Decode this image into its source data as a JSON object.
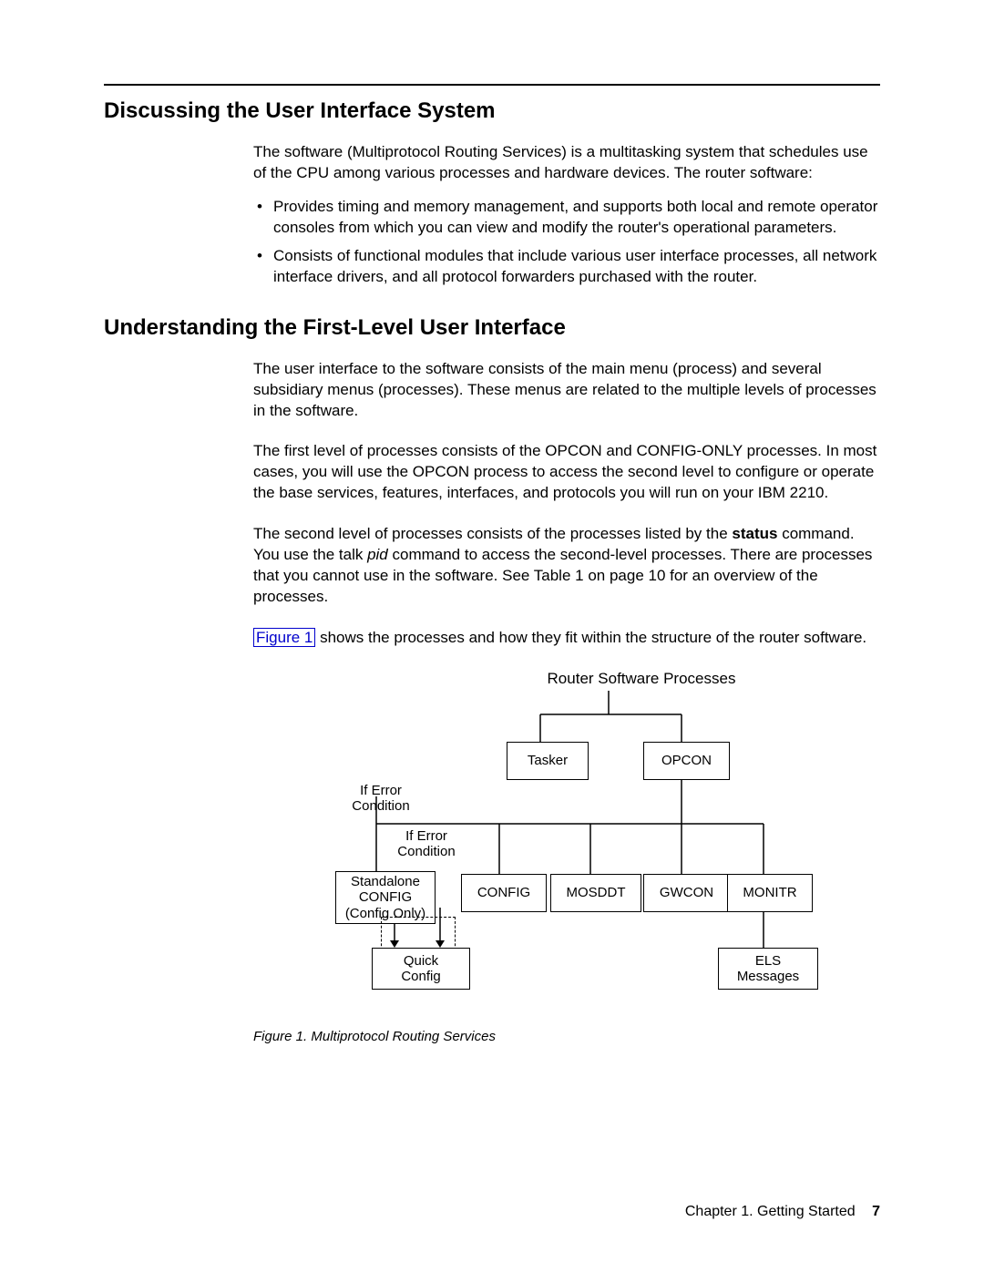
{
  "section1": {
    "heading": "Discussing the User Interface System",
    "intro": "The software (Multiprotocol Routing Services) is a multitasking system that schedules use of the CPU among various processes and hardware devices. The router software:",
    "bullets": [
      "Provides timing and memory management, and supports both local and remote operator consoles from which you can view and modify the router's operational parameters.",
      "Consists of functional modules that include various user interface processes, all network interface drivers, and all protocol forwarders purchased with the router."
    ]
  },
  "section2": {
    "heading": "Understanding the First-Level User Interface",
    "p1": "The user interface to the software consists of the main menu (process) and several subsidiary menus (processes). These menus are related to the multiple levels of processes in the software.",
    "p2": "The first level of processes consists of the OPCON and CONFIG-ONLY processes. In most cases, you will use the OPCON process to access the second level to configure or operate the base services, features, interfaces, and protocols you will run on your IBM 2210.",
    "p3_a": "The second level of processes consists of the processes listed by the ",
    "p3_status": "status",
    "p3_b": " command. You use the talk ",
    "p3_pid": "pid",
    "p3_c": " command to access the second-level processes. There are processes that you cannot use in the software. See Table 1 on page 10 for an overview of the processes.",
    "p4_link": "Figure 1",
    "p4_rest": " shows the processes and how they fit within the structure of the router software."
  },
  "diagram": {
    "title": "Router Software Processes",
    "tasker": "Tasker",
    "opcon": "OPCON",
    "iferr1": "If Error\nCondition",
    "iferr2": "If Error\nCondition",
    "standalone": "Standalone\nCONFIG\n(Config Only)",
    "config": "CONFIG",
    "mosddt": "MOSDDT",
    "gwcon": "GWCON",
    "monitr": "MONITR",
    "quick": "Quick\nConfig",
    "els": "ELS\nMessages",
    "caption": "Figure 1. Multiprotocol Routing Services"
  },
  "footer": {
    "chapter": "Chapter 1. Getting Started",
    "page": "7"
  }
}
